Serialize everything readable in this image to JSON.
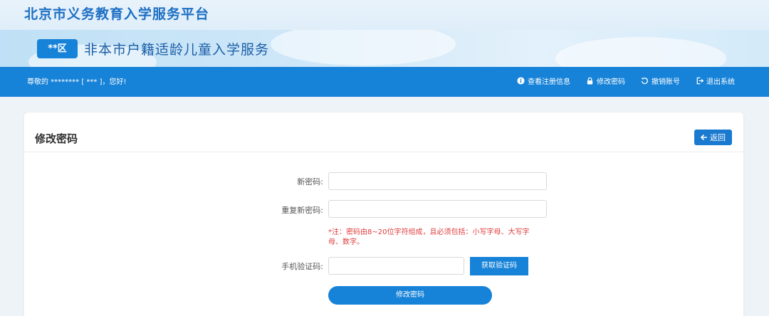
{
  "site": {
    "title": "北京市义务教育入学服务平台"
  },
  "banner": {
    "district": "**区",
    "service_title": "非本市户籍适龄儿童入学服务"
  },
  "nav": {
    "greeting": "尊敬的 ******** [ *** ]，您好!",
    "links": [
      {
        "label": "查看注册信息",
        "icon": "info-icon"
      },
      {
        "label": "修改密码",
        "icon": "lock-icon"
      },
      {
        "label": "撤销账号",
        "icon": "undo-icon"
      },
      {
        "label": "退出系统",
        "icon": "logout-icon"
      }
    ]
  },
  "card": {
    "title": "修改密码",
    "back_label": "返回"
  },
  "form": {
    "new_password_label": "新密码:",
    "new_password_value": "",
    "repeat_password_label": "重复新密码:",
    "repeat_password_value": "",
    "note": "*注：密码由8~20位字符组成，且必须包括：小写字母、大写字母、数字。",
    "sms_code_label": "手机验证码:",
    "sms_code_value": "",
    "get_code_label": "获取验证码",
    "submit_label": "修改密码"
  },
  "colors": {
    "primary": "#1682d8",
    "title": "#1d6fc4",
    "warning": "#e03b3b"
  }
}
